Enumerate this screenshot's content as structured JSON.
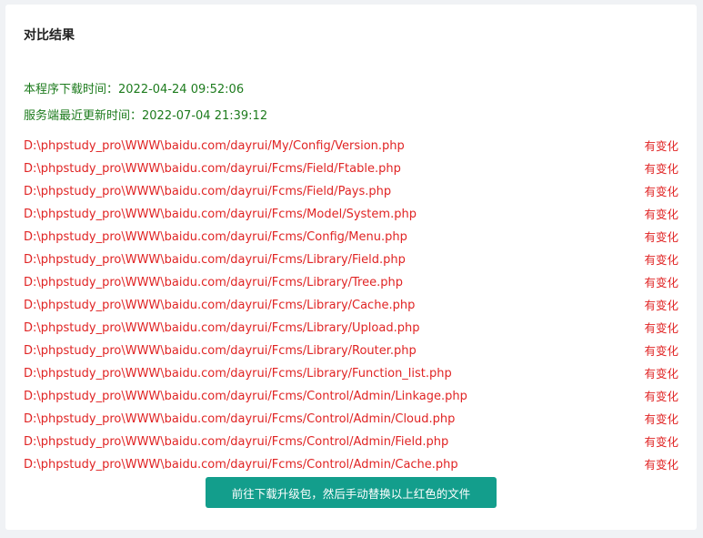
{
  "panel": {
    "title": "对比结果",
    "download_time_label": "本程序下载时间：",
    "download_time_value": "2022-04-24 09:52:06",
    "server_update_label": "服务端最近更新时间：",
    "server_update_value": "2022-07-04 21:39:12"
  },
  "files": [
    {
      "path": "D:\\phpstudy_pro\\WWW\\baidu.com/dayrui/My/Config/Version.php",
      "status": "有变化"
    },
    {
      "path": "D:\\phpstudy_pro\\WWW\\baidu.com/dayrui/Fcms/Field/Ftable.php",
      "status": "有变化"
    },
    {
      "path": "D:\\phpstudy_pro\\WWW\\baidu.com/dayrui/Fcms/Field/Pays.php",
      "status": "有变化"
    },
    {
      "path": "D:\\phpstudy_pro\\WWW\\baidu.com/dayrui/Fcms/Model/System.php",
      "status": "有变化"
    },
    {
      "path": "D:\\phpstudy_pro\\WWW\\baidu.com/dayrui/Fcms/Config/Menu.php",
      "status": "有变化"
    },
    {
      "path": "D:\\phpstudy_pro\\WWW\\baidu.com/dayrui/Fcms/Library/Field.php",
      "status": "有变化"
    },
    {
      "path": "D:\\phpstudy_pro\\WWW\\baidu.com/dayrui/Fcms/Library/Tree.php",
      "status": "有变化"
    },
    {
      "path": "D:\\phpstudy_pro\\WWW\\baidu.com/dayrui/Fcms/Library/Cache.php",
      "status": "有变化"
    },
    {
      "path": "D:\\phpstudy_pro\\WWW\\baidu.com/dayrui/Fcms/Library/Upload.php",
      "status": "有变化"
    },
    {
      "path": "D:\\phpstudy_pro\\WWW\\baidu.com/dayrui/Fcms/Library/Router.php",
      "status": "有变化"
    },
    {
      "path": "D:\\phpstudy_pro\\WWW\\baidu.com/dayrui/Fcms/Library/Function_list.php",
      "status": "有变化"
    },
    {
      "path": "D:\\phpstudy_pro\\WWW\\baidu.com/dayrui/Fcms/Control/Admin/Linkage.php",
      "status": "有变化"
    },
    {
      "path": "D:\\phpstudy_pro\\WWW\\baidu.com/dayrui/Fcms/Control/Admin/Cloud.php",
      "status": "有变化"
    },
    {
      "path": "D:\\phpstudy_pro\\WWW\\baidu.com/dayrui/Fcms/Control/Admin/Field.php",
      "status": "有变化"
    },
    {
      "path": "D:\\phpstudy_pro\\WWW\\baidu.com/dayrui/Fcms/Control/Admin/Cache.php",
      "status": "有变化"
    }
  ],
  "action": {
    "button_label": "前往下载升级包，然后手动替换以上红色的文件"
  },
  "colors": {
    "info_text": "#1d7b1d",
    "changed_text": "#e02424",
    "button_bg": "#139e8c"
  }
}
